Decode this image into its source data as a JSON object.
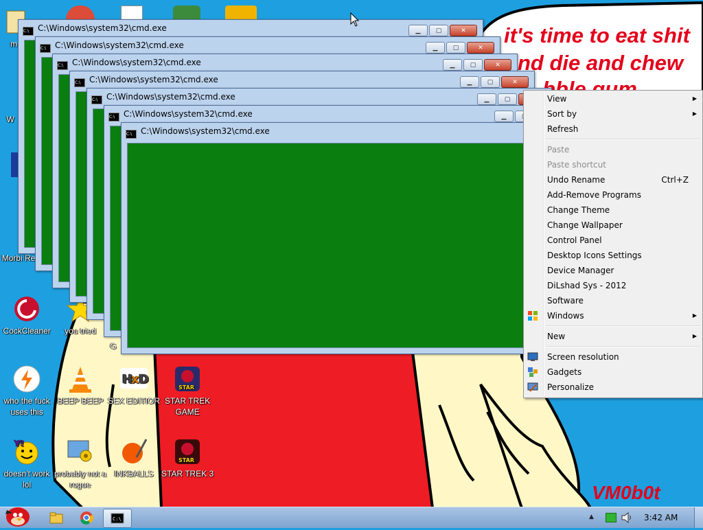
{
  "wallpaper": {
    "lines": [
      "it's time to eat shit",
      "nd die and chew",
      "bble gum"
    ],
    "signature": "VM0b0t"
  },
  "desktop_icons": [
    {
      "label": "m",
      "icon": "folder-icon"
    },
    {
      "label": "W",
      "icon": "app-icon"
    },
    {
      "label": "Morbi Reader",
      "icon": "reader-icon"
    },
    {
      "label": "CockCleaner",
      "icon": "ccleaner-icon"
    },
    {
      "label": "you tried",
      "icon": "star-icon"
    },
    {
      "label": "G",
      "icon": "app-icon"
    },
    {
      "label": "who the fuck uses this",
      "icon": "avast-icon"
    },
    {
      "label": "BEEP BEEP",
      "icon": "vlc-cone-icon"
    },
    {
      "label": "SEX EDITIOR",
      "icon": "hxd-icon"
    },
    {
      "label": "STAR TREK GAME",
      "icon": "star-wars-icon"
    },
    {
      "label": "doesn't work lol",
      "icon": "yahoo-messenger-icon"
    },
    {
      "label": "probably not a rogue",
      "icon": "computer-gears-icon"
    },
    {
      "label": "INKBALLS",
      "icon": "inkball-icon"
    },
    {
      "label": "STAR TREK 3",
      "icon": "star-wars-icon"
    }
  ],
  "cmd_windows": [
    {
      "title": "C:\\Windows\\system32\\cmd.exe"
    },
    {
      "title": "C:\\Windows\\system32\\cmd.exe"
    },
    {
      "title": "C:\\Windows\\system32\\cmd.exe"
    },
    {
      "title": "C:\\Windows\\system32\\cmd.exe"
    },
    {
      "title": "C:\\Windows\\system32\\cmd.exe"
    },
    {
      "title": "C:\\Windows\\system32\\cmd.exe"
    },
    {
      "title": "C:\\Windows\\system32\\cmd.exe"
    }
  ],
  "context_menu": {
    "items": [
      {
        "label": "View",
        "submenu": true
      },
      {
        "label": "Sort by",
        "submenu": true
      },
      {
        "label": "Refresh"
      },
      {
        "label": "Paste",
        "disabled": true
      },
      {
        "label": "Paste shortcut",
        "disabled": true
      },
      {
        "label": "Undo Rename",
        "shortcut": "Ctrl+Z"
      },
      {
        "label": "Add-Remove Programs"
      },
      {
        "label": "Change Theme"
      },
      {
        "label": "Change Wallpaper"
      },
      {
        "label": "Control Panel"
      },
      {
        "label": "Desktop Icons Settings"
      },
      {
        "label": "Device Manager"
      },
      {
        "label": "DiLshad Sys - 2012"
      },
      {
        "label": "Software"
      },
      {
        "label": "Windows",
        "submenu": true,
        "icon": "windows-logo-icon"
      },
      {
        "label": "New",
        "submenu": true
      },
      {
        "label": "Screen resolution",
        "icon": "display-icon"
      },
      {
        "label": "Gadgets",
        "icon": "gadgets-icon"
      },
      {
        "label": "Personalize",
        "icon": "personalize-icon"
      }
    ]
  },
  "taskbar": {
    "clock": "3:42 AM",
    "pinned": [
      "angry-birds-start-icon",
      "explorer-folder-icon",
      "chrome-icon",
      "cmd-icon"
    ]
  },
  "colors": {
    "desktop_bg": "#1ea0e0",
    "cmd_body": "#0a7f10",
    "wallpaper_text": "#e3001b"
  }
}
